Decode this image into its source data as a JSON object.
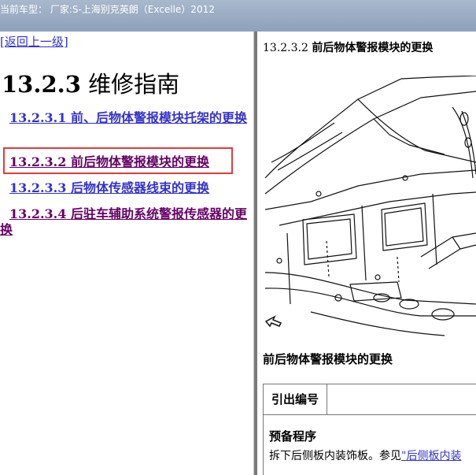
{
  "header": {
    "vehicle_label": "当前车型： 厂家:S-上海别克英朗（Excelle）2012"
  },
  "nav": {
    "back_link": "[返回上一级]"
  },
  "page": {
    "heading_number": "13.2.3",
    "heading_title": "维修指南"
  },
  "toc": [
    {
      "number": "13.2.3.1",
      "title": "前、后物体警报模块托架的更换"
    },
    {
      "number": "13.2.3.2",
      "title": "前后物体警报模块的更换"
    },
    {
      "number": "13.2.3.3",
      "title": "后物体传感器线束的更换"
    },
    {
      "number": "13.2.3.4",
      "title": "后驻车辅助系统警报传感器的更换"
    }
  ],
  "doc": {
    "title_number": "13.2.3.2",
    "title_text": "前后物体警报模块的更换",
    "section_heading": "前后物体警报模块的更换",
    "table_label": "引出编号",
    "prep_heading": "预备程序",
    "prep_text": "拆下后侧板内装饰板。参见",
    "prep_link": "\"后侧板内装"
  }
}
